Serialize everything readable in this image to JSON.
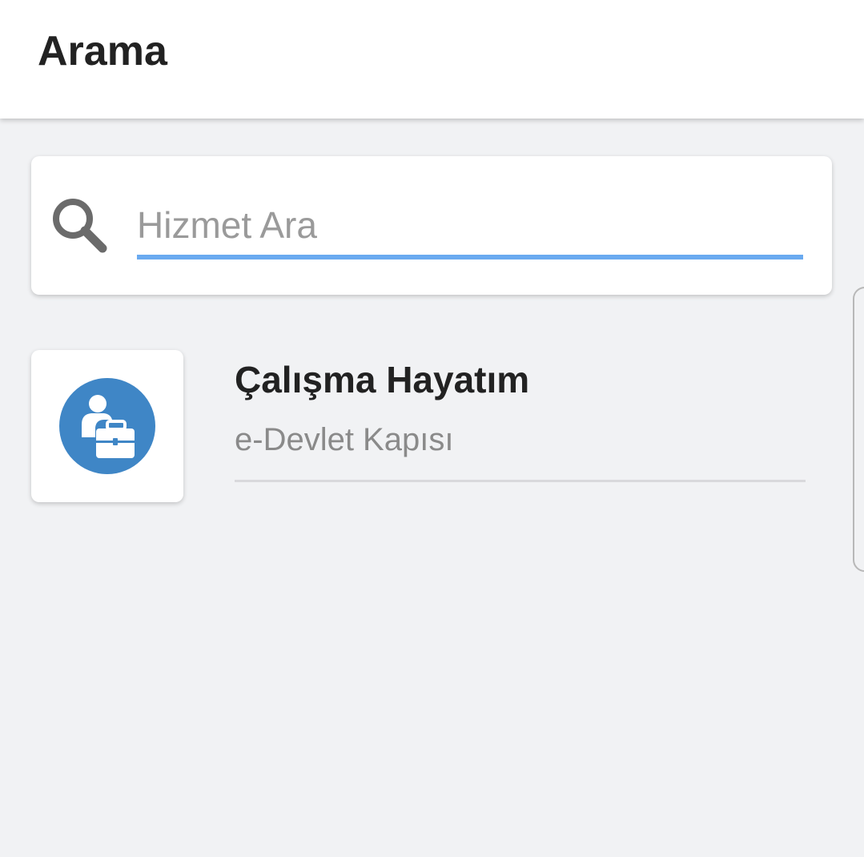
{
  "header": {
    "title": "Arama"
  },
  "search": {
    "placeholder": "Hizmet Ara",
    "value": "",
    "icon": "search-icon",
    "underline_color": "#6aaaf0"
  },
  "results": [
    {
      "title": "Çalışma Hayatım",
      "subtitle": "e-Devlet Kapısı",
      "icon": "person-briefcase-icon",
      "icon_color": "#3f86c6"
    }
  ]
}
